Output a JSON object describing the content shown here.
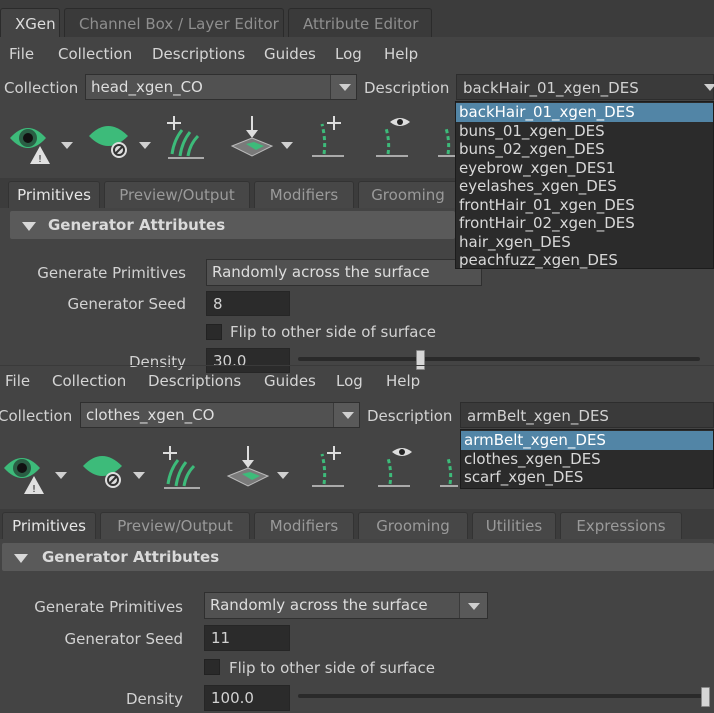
{
  "window_tabs": [
    {
      "label": "XGen"
    },
    {
      "label": "Channel Box / Layer Editor"
    },
    {
      "label": "Attribute Editor"
    }
  ],
  "menu": {
    "items": [
      "File",
      "Collection",
      "Descriptions",
      "Guides",
      "Log",
      "Help"
    ]
  },
  "top": {
    "collection_label": "Collection",
    "collection_value": "head_xgen_CO",
    "description_label": "Description",
    "description_value": "backHair_01_xgen_DES",
    "description_options": [
      "backHair_01_xgen_DES",
      "buns_01_xgen_DES",
      "buns_02_xgen_DES",
      "eyebrow_xgen_DES1",
      "eyelashes_xgen_DES",
      "frontHair_01_xgen_DES",
      "frontHair_02_xgen_DES",
      "hair_xgen_DES",
      "peachfuzz_xgen_DES"
    ],
    "subtabs": [
      "Primitives",
      "Preview/Output",
      "Modifiers",
      "Grooming"
    ],
    "section_title": "Generator Attributes",
    "generate_primitives_label": "Generate Primitives",
    "generate_primitives_value": "Randomly across the surface",
    "generator_seed_label": "Generator Seed",
    "generator_seed_value": "8",
    "flip_label": "Flip to other side of surface",
    "flip_checked": false,
    "density_label": "Density",
    "density_value": "30.0",
    "density_slider_fraction": 0.3
  },
  "bottom": {
    "collection_label": "Collection",
    "collection_value": "clothes_xgen_CO",
    "description_label": "Description",
    "description_value": "armBelt_xgen_DES",
    "description_options": [
      "armBelt_xgen_DES",
      "clothes_xgen_DES",
      "scarf_xgen_DES"
    ],
    "subtabs": [
      "Primitives",
      "Preview/Output",
      "Modifiers",
      "Grooming",
      "Utilities",
      "Expressions"
    ],
    "section_title": "Generator Attributes",
    "generate_primitives_label": "Generate Primitives",
    "generate_primitives_value": "Randomly across the surface",
    "generator_seed_label": "Generator Seed",
    "generator_seed_value": "11",
    "flip_label": "Flip to other side of surface",
    "flip_checked": false,
    "density_label": "Density",
    "density_value": "100.0",
    "density_slider_fraction": 1.0
  },
  "toolbar_icons": [
    "preview-eye-warning-icon",
    "leaf-disable-icon",
    "add-guides-icon",
    "place-points-icon",
    "add-single-guide-icon",
    "guide-visibility-icon"
  ],
  "colors": {
    "accent_green": "#3dbb7a",
    "selection_blue": "#5285a6",
    "panel": "#444444",
    "field": "#2b2b2b"
  }
}
